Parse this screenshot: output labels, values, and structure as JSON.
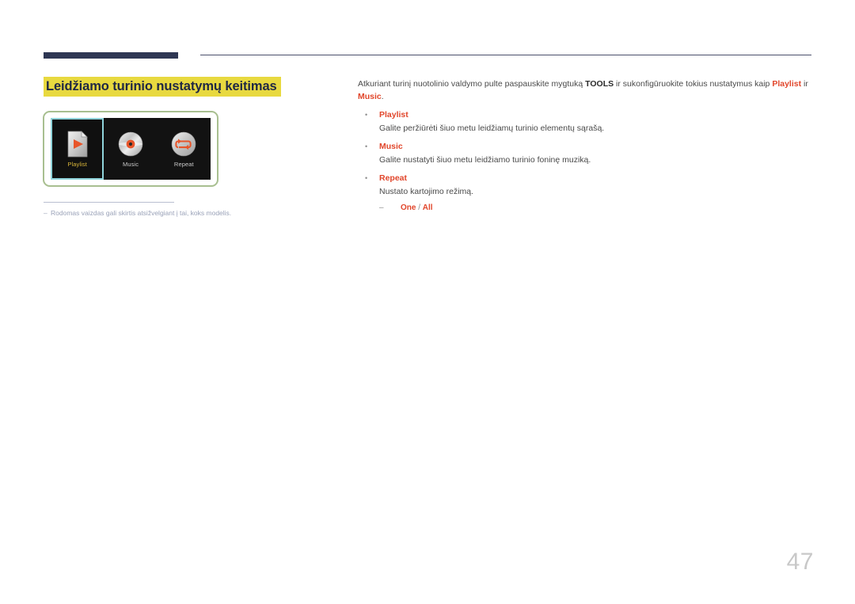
{
  "header": {
    "rule_thick_color": "#2e3653",
    "rule_thin_color": "#4a4f6b"
  },
  "title": {
    "text": "Leidžiamo turinio nustatymų keitimas",
    "highlight_color": "#e8d93f",
    "text_color": "#1f2744"
  },
  "figure": {
    "border_color": "#a8bf90",
    "screen_background": "#121212",
    "selection_border_color": "#8fd3da",
    "selected_label_color": "#d9b63a",
    "tiles": [
      {
        "label": "Playlist",
        "icon": "playlist-page-play-icon",
        "selected": true
      },
      {
        "label": "Music",
        "icon": "music-cd-disc-icon",
        "selected": false
      },
      {
        "label": "Repeat",
        "icon": "repeat-loop-arrow-icon",
        "selected": false
      }
    ],
    "note": {
      "dash": "‒",
      "text": "Rodomas vaizdas gali skirtis atsižvelgiant į tai, koks modelis."
    }
  },
  "content": {
    "intro": {
      "part1": "Atkuriant turinį nuotolinio valdymo pulte paspauskite mygtuką ",
      "bold_tools": "TOOLS",
      "part2": " ir sukonfigūruokite tokius nustatymus kaip ",
      "accent_playlist": "Playlist",
      "part3": " ir ",
      "accent_music": "Music",
      "part4": "."
    },
    "bullet_marker": "•",
    "items": [
      {
        "label": "Playlist",
        "description": "Galite peržiūrėti šiuo metu leidžiamų turinio elementų sąrašą."
      },
      {
        "label": "Music",
        "description": "Galite nustatyti šiuo metu leidžiamo turinio foninę muziką."
      },
      {
        "label": "Repeat",
        "description": "Nustato kartojimo režimą.",
        "sub": {
          "dash": "‒",
          "first": "One",
          "separator": " / ",
          "second": "All"
        }
      }
    ],
    "accent_color": "#e1462b"
  },
  "page_number": "47"
}
